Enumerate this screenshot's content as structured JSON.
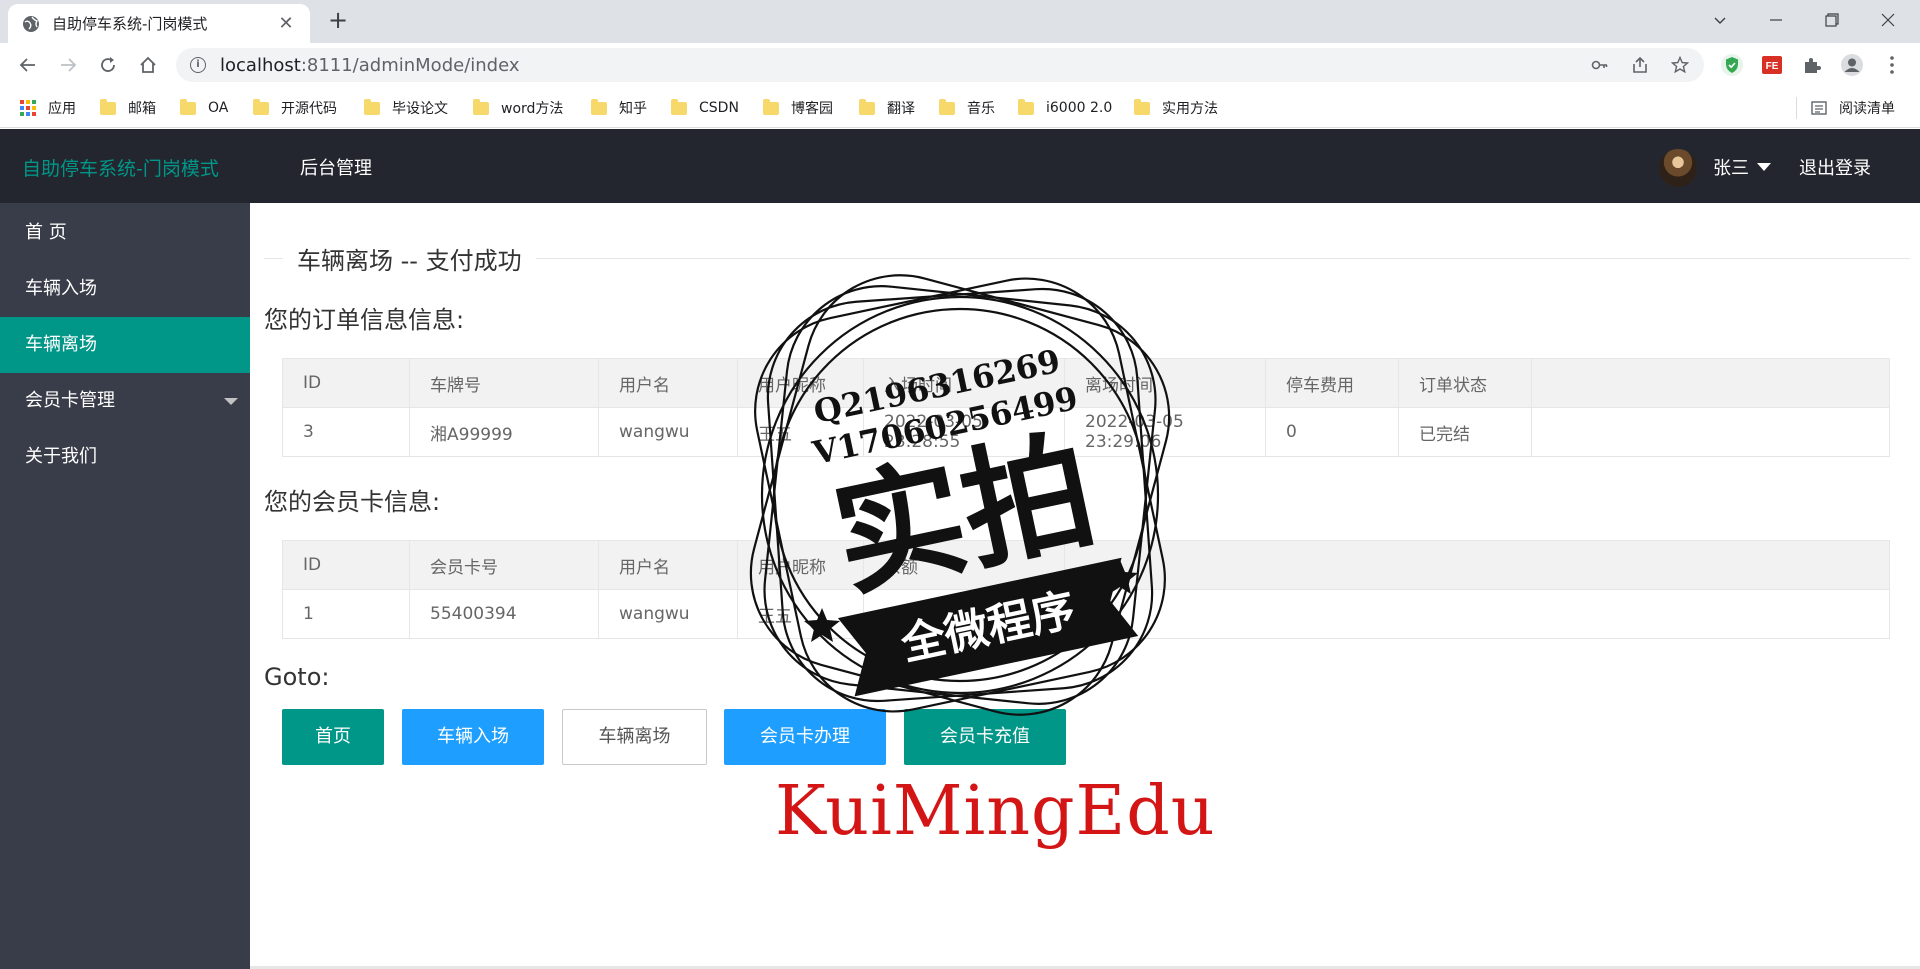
{
  "browser": {
    "tab_title": "自助停车系统-门岗模式",
    "tab_close": "✕",
    "new_tab": "+",
    "url_host": "localhost",
    "url_path": ":8111/adminMode/index",
    "window_controls": [
      "chevron-down",
      "minimize",
      "restore",
      "close"
    ],
    "bookmarks": [
      "应用",
      "邮箱",
      "OA",
      "开源代码",
      "毕设论文",
      "word方法",
      "知乎",
      "CSDN",
      "博客园",
      "翻译",
      "音乐",
      "i6000 2.0",
      "实用方法"
    ],
    "reading_list": "阅读清单",
    "ext_label": "FE"
  },
  "header": {
    "logo": "自助停车系统-门岗模式",
    "nav": "后台管理",
    "user": "张三",
    "logout": "退出登录"
  },
  "sidebar": {
    "items": [
      {
        "label": "首 页"
      },
      {
        "label": "车辆入场"
      },
      {
        "label": "车辆离场"
      },
      {
        "label": "会员卡管理"
      },
      {
        "label": "关于我们"
      }
    ],
    "active_index": 2
  },
  "main": {
    "legend": "车辆离场 -- 支付成功",
    "order_title": "您的订单信息信息:",
    "order_table": {
      "headers": [
        "ID",
        "车牌号",
        "用户名",
        "用户昵称",
        "入场时间",
        "离场时间",
        "停车费用",
        "订单状态",
        ""
      ],
      "rows": [
        [
          "3",
          "湘A99999",
          "wangwu",
          "王五",
          "2022-03-05 23:28:55",
          "2022-03-05 23:29:06",
          "0",
          "已完结",
          ""
        ]
      ]
    },
    "card_title": "您的会员卡信息:",
    "card_table": {
      "headers": [
        "ID",
        "会员卡号",
        "用户名",
        "用户昵称",
        "余额",
        ""
      ],
      "rows": [
        [
          "1",
          "55400394",
          "wangwu",
          "王五",
          "",
          ""
        ]
      ]
    },
    "goto": "Goto:",
    "buttons": [
      "首页",
      "车辆入场",
      "车辆离场",
      "会员卡办理",
      "会员卡充值"
    ]
  },
  "watermark": {
    "line1": "Q2196316269",
    "line2": "V17060256499",
    "big": "实拍",
    "ribbon": "全微程序",
    "footer": "KuiMingEdu"
  },
  "colors": {
    "header_bg": "#23262e",
    "sidebar_bg": "#393d49",
    "accent_green": "#009688",
    "accent_blue": "#1e9fff",
    "watermark_red": "#d31515"
  }
}
